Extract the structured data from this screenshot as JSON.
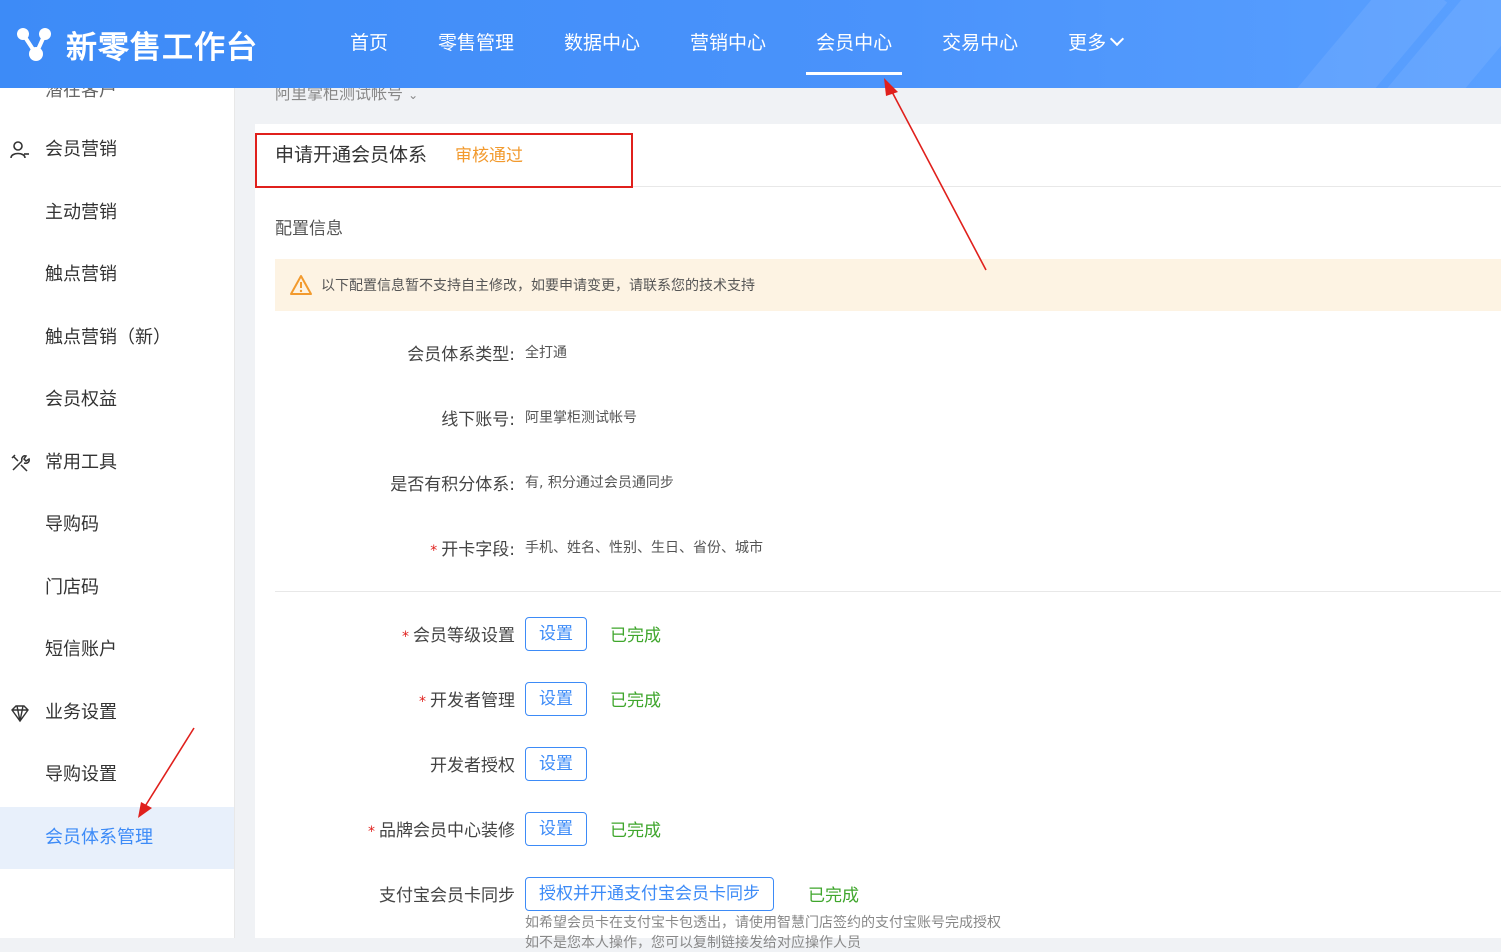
{
  "header": {
    "logo_text": "新零售工作台",
    "nav": [
      {
        "label": "首页"
      },
      {
        "label": "零售管理"
      },
      {
        "label": "数据中心"
      },
      {
        "label": "营销中心"
      },
      {
        "label": "会员中心",
        "active": true
      },
      {
        "label": "交易中心"
      },
      {
        "label": "更多"
      }
    ],
    "colors": {
      "brand": "#3d8bf7",
      "accent_orange": "#f29a2e",
      "success": "#3fa62c",
      "annotation_red": "#e0201c"
    }
  },
  "sidebar": {
    "partial_top": "潜在客户",
    "items": [
      {
        "label": "会员营销",
        "icon": "user-icon",
        "group": true
      },
      {
        "label": "主动营销"
      },
      {
        "label": "触点营销"
      },
      {
        "label": "触点营销（新）"
      },
      {
        "label": "会员权益"
      },
      {
        "label": "常用工具",
        "icon": "tools-icon",
        "group": true
      },
      {
        "label": "导购码"
      },
      {
        "label": "门店码"
      },
      {
        "label": "短信账户"
      },
      {
        "label": "业务设置",
        "icon": "diamond-icon",
        "group": true
      },
      {
        "label": "导购设置"
      },
      {
        "label": "会员体系管理",
        "active": true
      }
    ]
  },
  "main": {
    "breadcrumb": "阿里掌柜测试帐号",
    "card_title": "申请开通会员体系",
    "status": "审核通过",
    "section_title": "配置信息",
    "warning": "以下配置信息暂不支持自主修改，如要申请变更，请联系您的技术支持",
    "info_rows": [
      {
        "label": "会员体系类型:",
        "value": "全打通",
        "required": false
      },
      {
        "label": "线下账号:",
        "value": "阿里掌柜测试帐号",
        "required": false
      },
      {
        "label": "是否有积分体系:",
        "value": "有, 积分通过会员通同步",
        "required": false
      },
      {
        "label": "开卡字段:",
        "value": "手机、姓名、性别、生日、省份、城市",
        "required": true
      }
    ],
    "settings": [
      {
        "label": "会员等级设置",
        "required": true,
        "button": "设置",
        "status": "已完成"
      },
      {
        "label": "开发者管理",
        "required": true,
        "button": "设置",
        "status": "已完成"
      },
      {
        "label": "开发者授权",
        "required": false,
        "button": "设置",
        "status": ""
      },
      {
        "label": "品牌会员中心装修",
        "required": true,
        "button": "设置",
        "status": "已完成"
      },
      {
        "label": "支付宝会员卡同步",
        "required": false,
        "button": "授权并开通支付宝会员卡同步",
        "status": "已完成"
      }
    ],
    "alipay_hint": "如希望会员卡在支付宝卡包透出，请使用智慧门店签约的支付宝账号完成授权",
    "alipay_hint2": "如不是您本人操作，您可以复制链接发给对应操作人员"
  }
}
